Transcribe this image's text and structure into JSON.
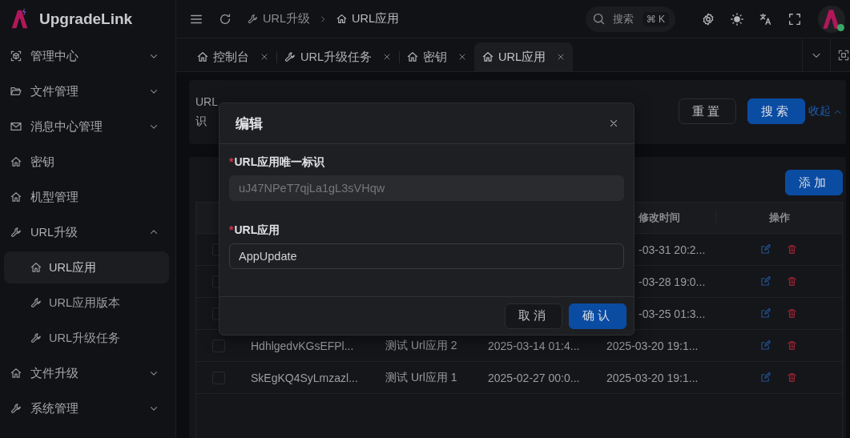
{
  "brand": {
    "name": "UpgradeLink"
  },
  "sidebar": {
    "items": [
      {
        "label": "管理中心",
        "kind": "group",
        "expanded": false
      },
      {
        "label": "文件管理",
        "kind": "group",
        "expanded": false
      },
      {
        "label": "消息中心管理",
        "kind": "group",
        "expanded": false
      },
      {
        "label": "密钥",
        "kind": "leaf"
      },
      {
        "label": "机型管理",
        "kind": "leaf"
      },
      {
        "label": "URL升级",
        "kind": "group",
        "expanded": true,
        "children": [
          {
            "label": "URL应用",
            "selected": true
          },
          {
            "label": "URL应用版本",
            "selected": false
          },
          {
            "label": "URL升级任务",
            "selected": false
          }
        ]
      },
      {
        "label": "文件升级",
        "kind": "group",
        "expanded": false
      },
      {
        "label": "系统管理",
        "kind": "group",
        "expanded": false
      }
    ]
  },
  "header": {
    "breadcrumb": [
      {
        "label": "URL升级"
      },
      {
        "label": "URL应用"
      }
    ],
    "search": {
      "placeholder": "搜索",
      "shortcut": "⌘ K"
    }
  },
  "tabs": [
    {
      "label": "控制台",
      "selected": false
    },
    {
      "label": "URL升级任务",
      "selected": false
    },
    {
      "label": "密钥",
      "selected": false
    },
    {
      "label": "URL应用",
      "selected": true
    }
  ],
  "filter": {
    "label_lines": [
      "URL",
      "识"
    ],
    "reset": "重置",
    "search": "搜索",
    "collapse": "收起"
  },
  "table": {
    "add": "添加",
    "columns": [
      "修改时间",
      "操作"
    ],
    "rows": [
      {
        "checked": false,
        "modified": "-03-31 20:2..."
      },
      {
        "checked": false,
        "modified": "-03-28 19:0..."
      },
      {
        "checked": false,
        "modified": "-03-25 01:3..."
      },
      {
        "checked": false,
        "id": "HdhlgedvKGsEFPl...",
        "name": "测试 Url应用 2",
        "created": "2025-03-14 01:4...",
        "modified": "2025-03-20 19:1..."
      },
      {
        "checked": false,
        "id": "SkEgKQ4SyLmzazl...",
        "name": "测试 Url应用 1",
        "created": "2025-02-27 00:0...",
        "modified": "2025-03-20 19:1..."
      }
    ]
  },
  "modal": {
    "title": "编辑",
    "fields": [
      {
        "label": "URL应用唯一标识",
        "required_mark": "*",
        "value": "uJ47NPeT7qjLa1gL3sVHqw",
        "disabled": true
      },
      {
        "label": "URL应用",
        "required_mark": "*",
        "value": "AppUpdate",
        "disabled": false
      }
    ],
    "cancel": "取消",
    "confirm": "确认"
  }
}
